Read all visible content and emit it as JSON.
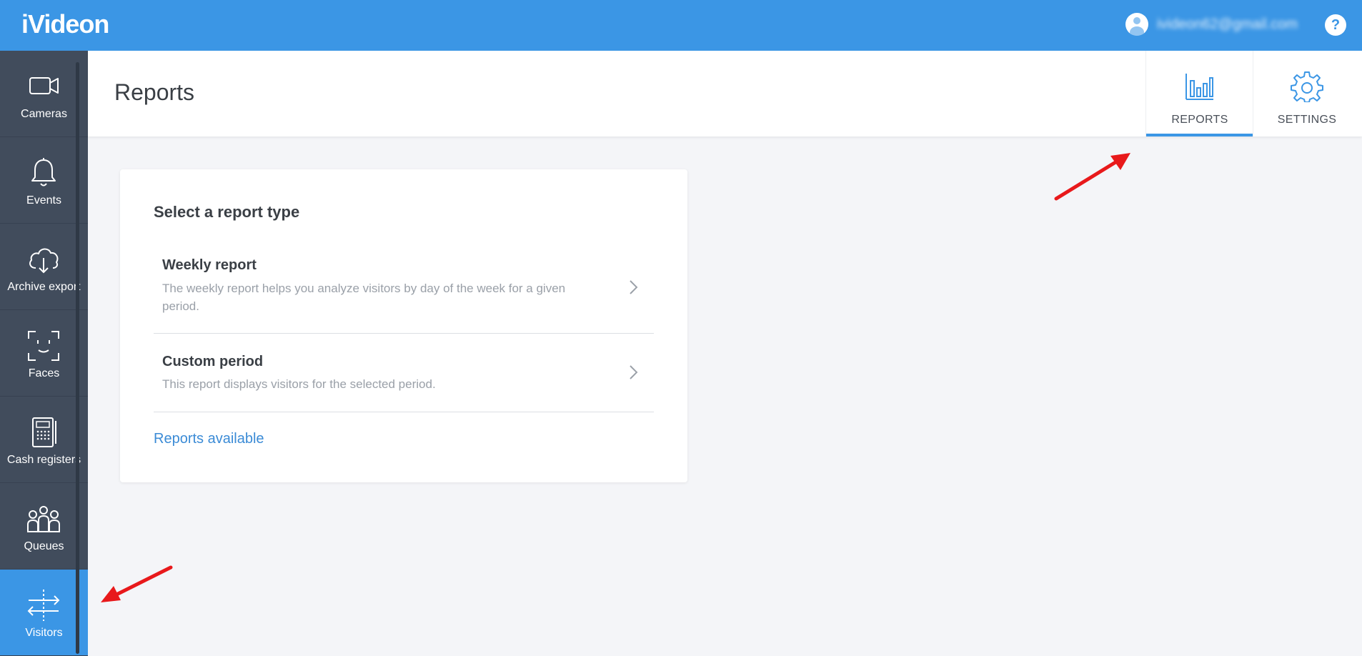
{
  "app": {
    "logo": "iVideon",
    "user_email": "ivideon62@gmail.com",
    "help_label": "?"
  },
  "sidebar": {
    "items": [
      {
        "label": "Cameras",
        "icon": "camera-icon"
      },
      {
        "label": "Events",
        "icon": "bell-icon"
      },
      {
        "label": "Archive export",
        "icon": "cloud-download-icon"
      },
      {
        "label": "Faces",
        "icon": "face-scan-icon"
      },
      {
        "label": "Cash registers",
        "icon": "calculator-icon"
      },
      {
        "label": "Queues",
        "icon": "people-icon"
      },
      {
        "label": "Visitors",
        "icon": "visitors-flow-icon",
        "active": true
      }
    ]
  },
  "header": {
    "title": "Reports",
    "tabs": [
      {
        "label": "REPORTS",
        "icon": "bar-chart-icon",
        "active": true
      },
      {
        "label": "SETTINGS",
        "icon": "gear-icon"
      }
    ]
  },
  "card": {
    "title": "Select a report type",
    "options": [
      {
        "title": "Weekly report",
        "description": "The weekly report helps you analyze visitors by day of the week for a given period."
      },
      {
        "title": "Custom period",
        "description": "This report displays visitors for the selected period."
      }
    ],
    "link": "Reports available"
  },
  "colors": {
    "accent": "#3b96e5",
    "sidebar": "#414c5c",
    "annotation_arrow": "#e8191b"
  }
}
